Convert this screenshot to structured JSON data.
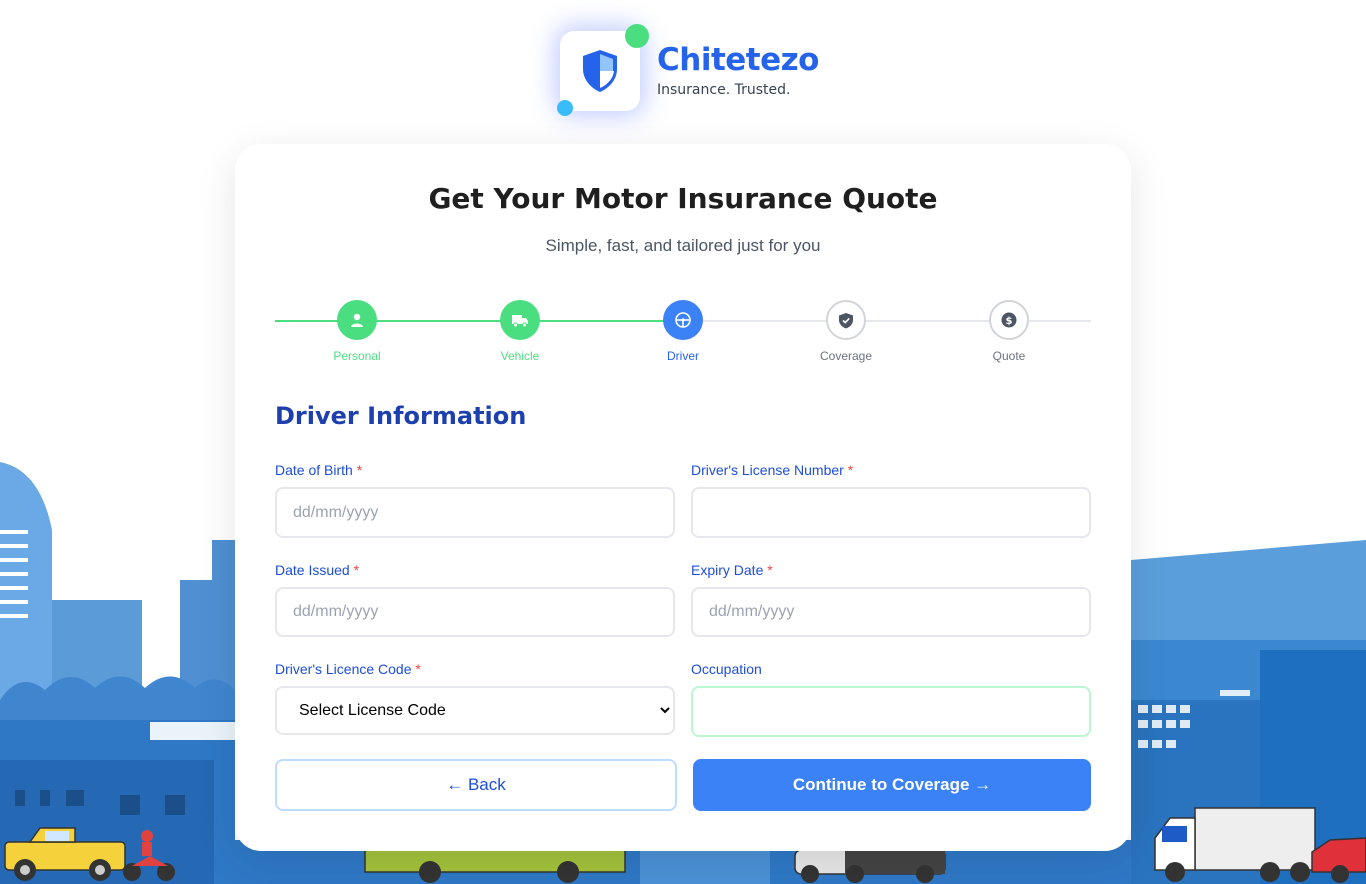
{
  "brand": {
    "name": "Chitetezo",
    "tagline": "Insurance. Trusted."
  },
  "header": {
    "title": "Get Your Motor Insurance Quote",
    "subtitle": "Simple, fast, and tailored just for you"
  },
  "steps": [
    {
      "label": "Personal",
      "status": "completed",
      "icon": "user-icon"
    },
    {
      "label": "Vehicle",
      "status": "completed",
      "icon": "truck-icon"
    },
    {
      "label": "Driver",
      "status": "active",
      "icon": "steering-wheel-icon"
    },
    {
      "label": "Coverage",
      "status": "pending",
      "icon": "shield-check-icon"
    },
    {
      "label": "Quote",
      "status": "pending",
      "icon": "dollar-icon"
    }
  ],
  "form": {
    "section_title": "Driver Information",
    "required_marker": "*",
    "dob": {
      "label": "Date of Birth",
      "placeholder": "dd/mm/yyyy",
      "value": ""
    },
    "license_number": {
      "label": "Driver's License Number",
      "placeholder": "",
      "value": ""
    },
    "date_issued": {
      "label": "Date Issued",
      "placeholder": "dd/mm/yyyy",
      "value": ""
    },
    "expiry_date": {
      "label": "Expiry Date",
      "placeholder": "dd/mm/yyyy",
      "value": ""
    },
    "licence_code": {
      "label": "Driver's Licence Code",
      "selected": "Select License Code"
    },
    "occupation": {
      "label": "Occupation",
      "placeholder": "",
      "value": ""
    }
  },
  "actions": {
    "back_label": "← Back",
    "continue_label": "Continue to Coverage →"
  },
  "colors": {
    "primary": "#3b82f6",
    "success": "#4ade80",
    "heading_blue": "#1e40af",
    "required": "#ef4444"
  }
}
